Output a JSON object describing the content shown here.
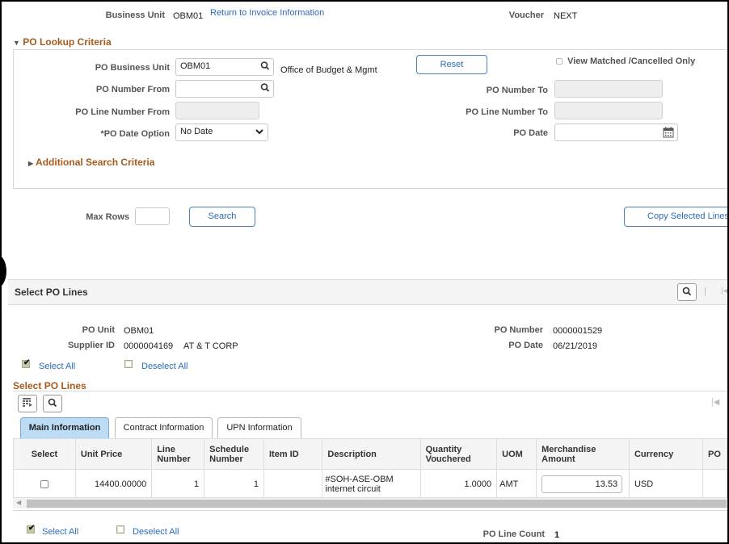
{
  "header": {
    "business_unit_label": "Business Unit",
    "business_unit_value": "OBM01",
    "return_link": "Return to Invoice Information",
    "voucher_label": "Voucher",
    "voucher_value": "NEXT"
  },
  "lookup": {
    "section_title": "PO Lookup Criteria",
    "po_business_unit_label": "PO Business Unit",
    "po_business_unit_value": "OBM01",
    "po_business_unit_desc": "Office of Budget & Mgmt",
    "reset_label": "Reset",
    "view_matched_label": "View Matched /Cancelled Only",
    "view_matched_checked": false,
    "po_number_from_label": "PO Number From",
    "po_number_from_value": "",
    "po_number_to_label": "PO Number To",
    "po_number_to_value": "",
    "po_line_from_label": "PO Line Number From",
    "po_line_from_value": "",
    "po_line_to_label": "PO Line Number To",
    "po_line_to_value": "",
    "po_date_option_label": "*PO Date Option",
    "po_date_option_value": "No Date",
    "po_date_label": "PO Date",
    "po_date_value": "",
    "additional_criteria": "Additional Search Criteria"
  },
  "search": {
    "max_rows_label": "Max Rows",
    "max_rows_value": "",
    "search_label": "Search",
    "copy_label": "Copy Selected Lines"
  },
  "po_lines": {
    "header_title": "Select PO Lines",
    "po_unit_label": "PO Unit",
    "po_unit_value": "OBM01",
    "supplier_id_label": "Supplier ID",
    "supplier_id_value": "0000004169",
    "supplier_name": "AT & T CORP",
    "po_number_label": "PO Number",
    "po_number_value": "0000001529",
    "po_date_label": "PO Date",
    "po_date_value": "06/21/2019",
    "select_all": "Select All",
    "deselect_all": "Deselect All",
    "grid_title": "Select PO Lines",
    "tabs": [
      {
        "label": "Main Information",
        "active": true
      },
      {
        "label": "Contract Information",
        "active": false
      },
      {
        "label": "UPN Information",
        "active": false
      }
    ],
    "columns": [
      "Select",
      "Unit Price",
      "Line Number",
      "Schedule Number",
      "Item ID",
      "Description",
      "Quantity Vouchered",
      "UOM",
      "Merchandise Amount",
      "Currency",
      "PO"
    ],
    "rows": [
      {
        "select": false,
        "unit_price": "14400.00000",
        "line_number": "1",
        "schedule_number": "1",
        "item_id": "",
        "description": "#SOH-ASE-OBM internet circuit",
        "quantity_vouchered": "1.0000",
        "uom": "AMT",
        "merchandise_amount": "13.53",
        "currency": "USD",
        "po": ""
      }
    ],
    "bottom_select_all": "Select All",
    "bottom_deselect_all": "Deselect All",
    "line_count_label": "PO Line Count",
    "line_count_value": "1"
  }
}
